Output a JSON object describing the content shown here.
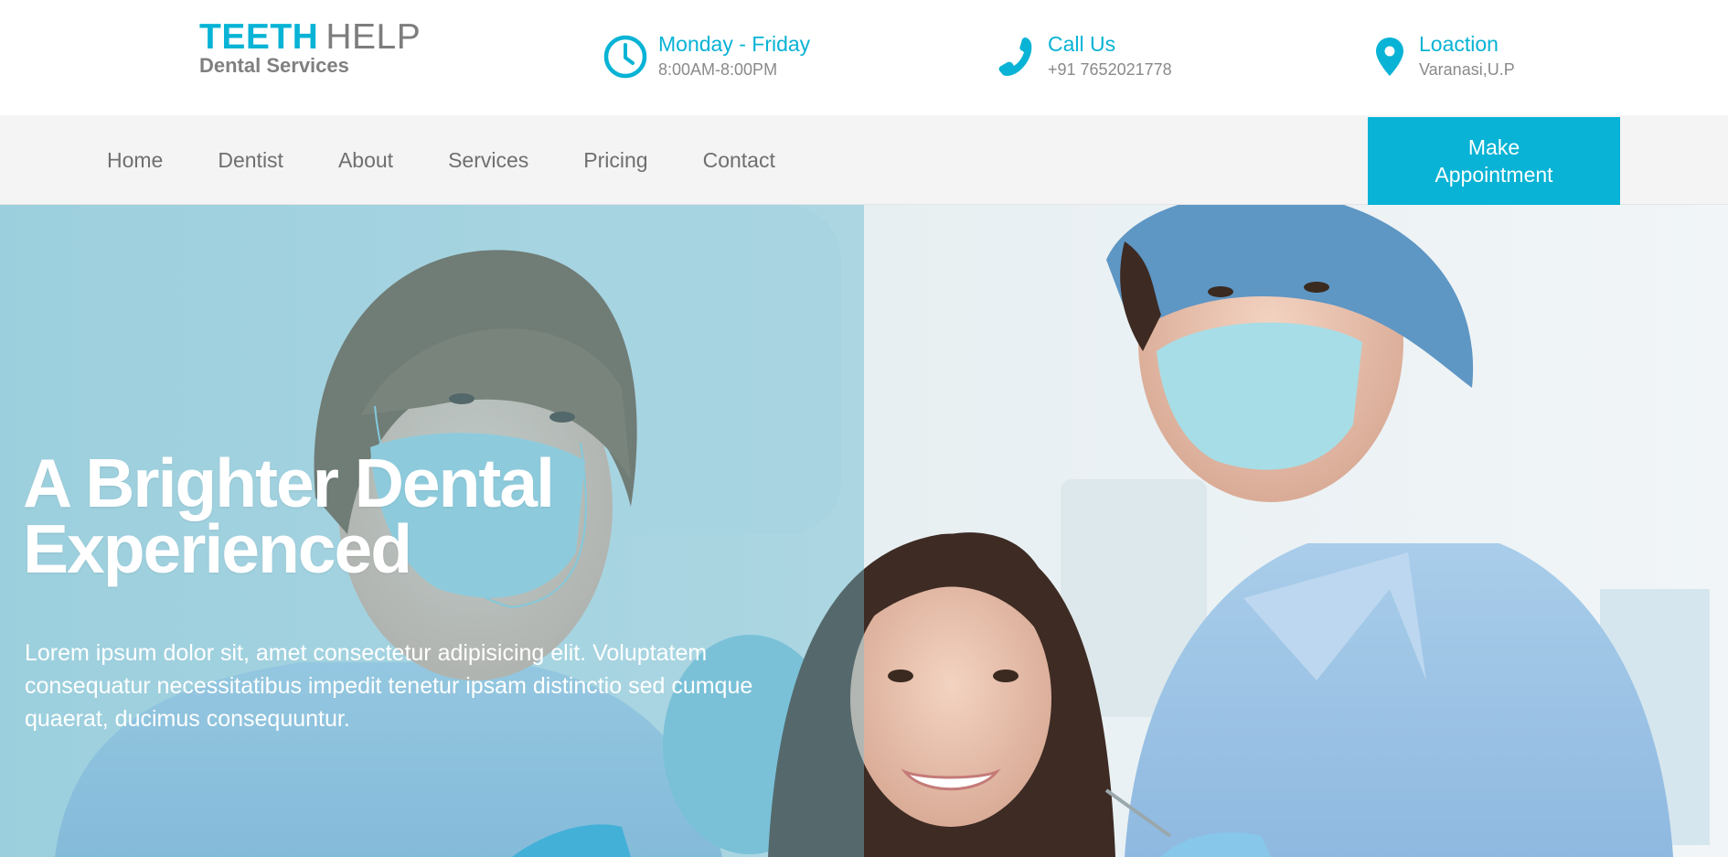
{
  "brand": {
    "name_part1": "TEETH",
    "name_part2": "HELP",
    "tagline": "Dental Services",
    "accent_color": "#08b3d5"
  },
  "info": {
    "hours": {
      "icon": "clock-icon",
      "title": "Monday - Friday",
      "value": "8:00AM-8:00PM"
    },
    "call": {
      "icon": "phone-icon",
      "title": "Call Us",
      "value": "+91 7652021778"
    },
    "location": {
      "icon": "map-pin-icon",
      "title": "Loaction",
      "value": "Varanasi,U.P"
    }
  },
  "nav": {
    "items": [
      "Home",
      "Dentist",
      "About",
      "Services",
      "Pricing",
      "Contact"
    ],
    "cta_label": "Make Appointment"
  },
  "hero": {
    "heading": "A Brighter Dental Experienced",
    "body": "Lorem ipsum dolor sit, amet consectetur adipisicing elit. Voluptatem consequatur necessitatibus impedit tenetur ipsam distinctio sed cumque quaerat, ducimus consequuntur."
  }
}
